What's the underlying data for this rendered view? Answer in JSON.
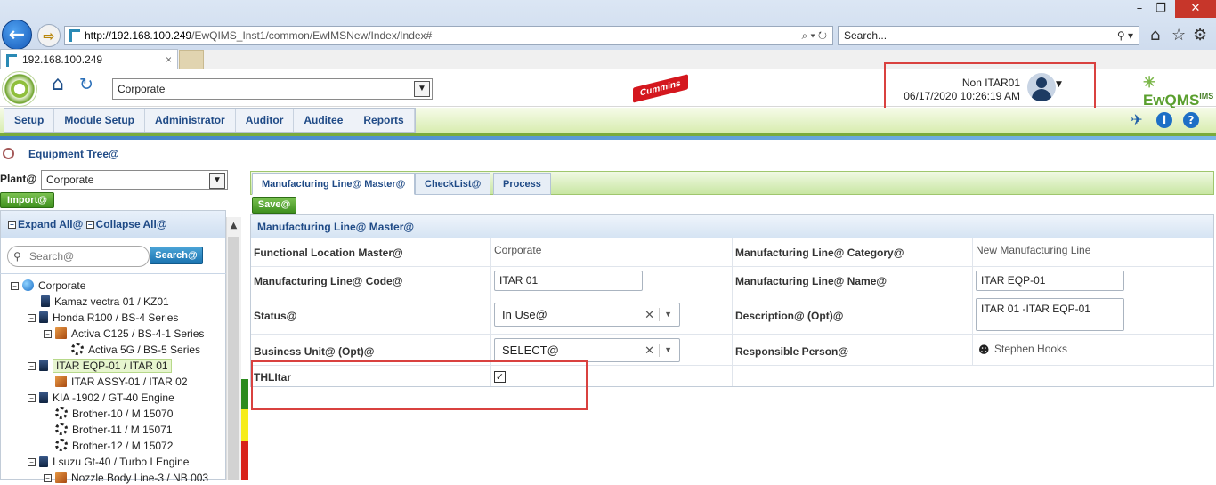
{
  "browser": {
    "url_host": "http://192.168.100.249",
    "url_rest": "/EwQIMS_Inst1/common/EwIMSNew/Index/Index#",
    "search_placeholder": "Search...",
    "tab_title": "192.168.100.249"
  },
  "header": {
    "plant_selector": "Corporate",
    "brand_logo": "Cummins",
    "user_name": "Non ITAR01",
    "datetime": "06/17/2020 10:26:19 AM",
    "app_logo_main": "EwQMS",
    "app_logo_sup": "IMS"
  },
  "menu": [
    "Setup",
    "Module Setup",
    "Administrator",
    "Auditor",
    "Auditee",
    "Reports"
  ],
  "breadcrumb": "Equipment Tree@",
  "left": {
    "plant_label": "Plant@",
    "plant_value": "Corporate",
    "import_label": "Import@",
    "expand_label": "Expand All@",
    "collapse_label": "Collapse All@",
    "search_placeholder": "Search@",
    "search_button": "Search@",
    "tree": [
      {
        "label": "Corporate",
        "icon": "globe-icon"
      },
      {
        "label": "Kamaz vectra 01 / KZ01",
        "icon": "device-icon"
      },
      {
        "label": "Honda R100 / BS-4 Series",
        "icon": "device-icon"
      },
      {
        "label": "Activa C125 / BS-4-1 Series",
        "icon": "box-icon"
      },
      {
        "label": "Activa 5G / BS-5 Series",
        "icon": "gear-icon"
      },
      {
        "label": "ITAR EQP-01 / ITAR 01",
        "icon": "device-icon"
      },
      {
        "label": "ITAR ASSY-01 / ITAR 02",
        "icon": "box-icon"
      },
      {
        "label": "KIA -1902 / GT-40 Engine",
        "icon": "device-icon"
      },
      {
        "label": "Brother-10 / M 15070",
        "icon": "gear-icon"
      },
      {
        "label": "Brother-11 / M 15071",
        "icon": "gear-icon"
      },
      {
        "label": "Brother-12 / M 15072",
        "icon": "gear-icon"
      },
      {
        "label": "I suzu Gt-40 / Turbo I Engine",
        "icon": "device-icon"
      },
      {
        "label": "Nozzle Body Line-3 / NB 003",
        "icon": "box-icon"
      }
    ]
  },
  "tabs": [
    "Manufacturing Line@ Master@",
    "CheckList@",
    "Process"
  ],
  "save_label": "Save@",
  "form": {
    "title": "Manufacturing Line@ Master@",
    "functional_location_label": "Functional Location Master@",
    "functional_location_value": "Corporate",
    "category_label": "Manufacturing Line@ Category@",
    "category_value": "New Manufacturing Line",
    "code_label": "Manufacturing Line@ Code@",
    "code_value": "ITAR 01",
    "name_label": "Manufacturing Line@ Name@",
    "name_value": "ITAR EQP-01",
    "status_label": "Status@",
    "status_value": "In Use@",
    "description_label": "Description@ (Opt)@",
    "description_value": "ITAR 01 -ITAR EQP-01",
    "business_unit_label": "Business Unit@ (Opt)@",
    "business_unit_value": "SELECT@",
    "responsible_label": "Responsible Person@",
    "responsible_value": "Stephen Hooks",
    "thlitar_label": "THLItar",
    "thlitar_checked": true
  }
}
